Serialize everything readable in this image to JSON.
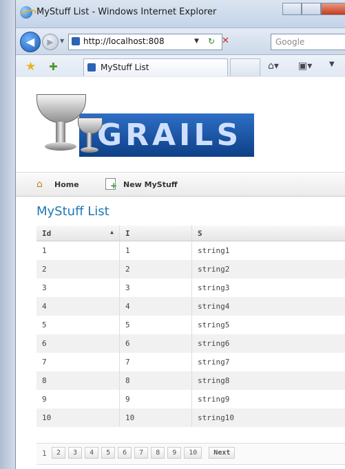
{
  "window": {
    "title": "MyStuff List - Windows Internet Explorer"
  },
  "browser": {
    "url": "http://localhost:808",
    "search_placeholder": "Google",
    "tab_title": "MyStuff List"
  },
  "nav": {
    "home": "Home",
    "new": "New MyStuff"
  },
  "page": {
    "logo_text": "GRAILS",
    "heading": "MyStuff List"
  },
  "table": {
    "headers": [
      "Id",
      "I",
      "S"
    ],
    "rows": [
      [
        "1",
        "1",
        "string1"
      ],
      [
        "2",
        "2",
        "string2"
      ],
      [
        "3",
        "3",
        "string3"
      ],
      [
        "4",
        "4",
        "string4"
      ],
      [
        "5",
        "5",
        "string5"
      ],
      [
        "6",
        "6",
        "string6"
      ],
      [
        "7",
        "7",
        "string7"
      ],
      [
        "8",
        "8",
        "string8"
      ],
      [
        "9",
        "9",
        "string9"
      ],
      [
        "10",
        "10",
        "string10"
      ]
    ]
  },
  "pager": {
    "current": "1",
    "pages": [
      "2",
      "3",
      "4",
      "5",
      "6",
      "7",
      "8",
      "9",
      "10"
    ],
    "next": "Next"
  }
}
